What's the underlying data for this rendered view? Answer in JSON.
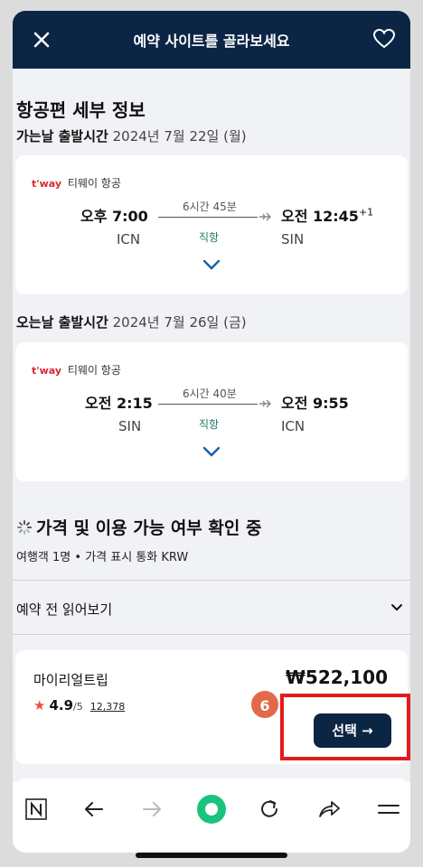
{
  "header": {
    "title": "예약 사이트를 골라보세요",
    "close_icon": "close-icon",
    "heart_icon": "heart-icon"
  },
  "details": {
    "title": "항공편 세부 정보"
  },
  "outbound": {
    "label": "가는날 출발시간",
    "date": "2024년 7월 22일 (월)",
    "airline_logo": "t'way",
    "airline_name": "티웨이 항공",
    "depart_time": "오후 7:00",
    "arrive_time": "오전 12:45",
    "day_offset": "+1",
    "duration": "6시간 45분",
    "stops": "직항",
    "from": "ICN",
    "to": "SIN"
  },
  "inbound": {
    "label": "오는날 출발시간",
    "date": "2024년 7월 26일 (금)",
    "airline_logo": "t'way",
    "airline_name": "티웨이 항공",
    "depart_time": "오전 2:15",
    "arrive_time": "오전 9:55",
    "duration": "6시간 40분",
    "stops": "직항",
    "from": "SIN",
    "to": "ICN"
  },
  "status": {
    "loading_text": "가격 및 이용 가능 여부 확인 중",
    "travelers": "여행객 1명",
    "currency": "가격 표시 통화 KRW"
  },
  "read_before": {
    "label": "예약 전 읽어보기"
  },
  "offer": {
    "vendor": "마이리얼트립",
    "price": "₩522,100",
    "rating": "4.9",
    "rating_scale": "/5",
    "review_count": "12,378",
    "select_label": "선택 →",
    "step_badge": "6"
  },
  "colors": {
    "header_bg": "#0b2545",
    "button_bg": "#0b2545",
    "highlight": "#e31b1b",
    "badge": "#e2694a",
    "direct_text": "#1f7a6d",
    "star": "#ef4d3c",
    "record_icon": "#19c37d"
  },
  "bottom_nav": {
    "icons": [
      "naver-n-icon",
      "back-arrow-icon",
      "forward-arrow-icon",
      "record-icon",
      "reload-icon",
      "share-icon",
      "menu-icon"
    ]
  }
}
